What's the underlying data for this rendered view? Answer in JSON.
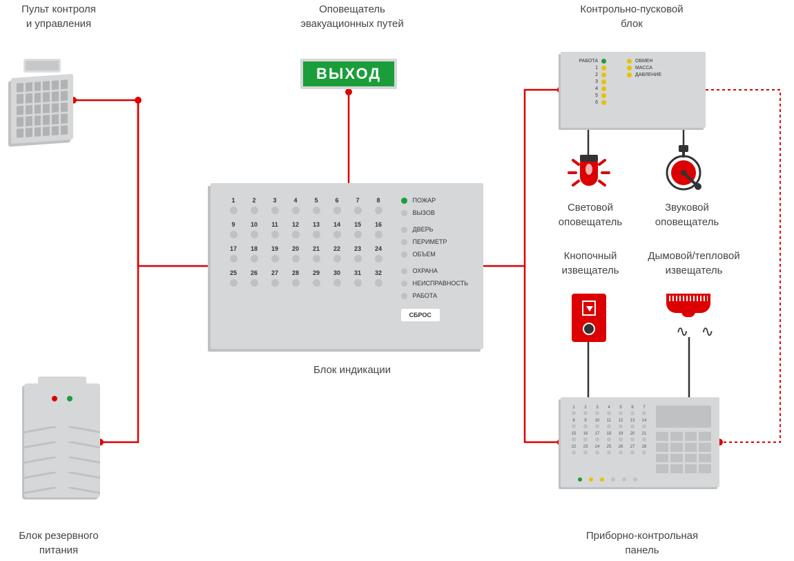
{
  "labels": {
    "control_keypad": "Пульт контроля\nи управления",
    "evac_annunciator": "Оповещатель\nэвакуационных путей",
    "control_launch_block": "Контрольно-пусковой\nблок",
    "exit_sign_text": "ВЫХОД",
    "indication_block": "Блок индикации",
    "backup_power": "Блок резервного\nпитания",
    "light_ann": "Световой\nоповещатель",
    "sound_ann": "Звуковой\nоповещатель",
    "button_detector": "Кнопочный\nизвещатель",
    "smoke_detector": "Дымовой/тепловой\nизвещатель",
    "control_panel": "Приборно-контрольная\nпанель"
  },
  "clblock": {
    "rabota": "РАБОТА",
    "obmen": "ОБМЕН",
    "massa": "МАССА",
    "davlenie": "ДАВЛЕНИЕ",
    "nums": [
      "1",
      "2",
      "3",
      "4",
      "5",
      "6"
    ]
  },
  "indication": {
    "zones": [
      "1",
      "2",
      "3",
      "4",
      "5",
      "6",
      "7",
      "8",
      "9",
      "10",
      "11",
      "12",
      "13",
      "14",
      "15",
      "16",
      "17",
      "18",
      "19",
      "20",
      "21",
      "22",
      "23",
      "24",
      "25",
      "26",
      "27",
      "28",
      "29",
      "30",
      "31",
      "32"
    ],
    "statuses": {
      "fire": "ПОЖАР",
      "call": "ВЫЗОВ",
      "door": "ДВЕРЬ",
      "perimeter": "ПЕРИМЕТР",
      "volume": "ОБЪЕМ",
      "guard": "ОХРАНА",
      "fault": "НЕИСПРАВНОСТЬ",
      "work": "РАБОТА"
    },
    "reset": "СБРОС"
  },
  "ctrl_panel": {
    "zones": [
      "1",
      "2",
      "3",
      "4",
      "5",
      "6",
      "7",
      "8",
      "9",
      "10",
      "11",
      "12",
      "13",
      "14",
      "15",
      "16",
      "17",
      "18",
      "19",
      "20",
      "21",
      "22",
      "23",
      "24",
      "25",
      "26",
      "27",
      "28"
    ]
  },
  "colors": {
    "red": "#dc0000",
    "green": "#1b9d3a",
    "grey": "#d5d7d8"
  }
}
